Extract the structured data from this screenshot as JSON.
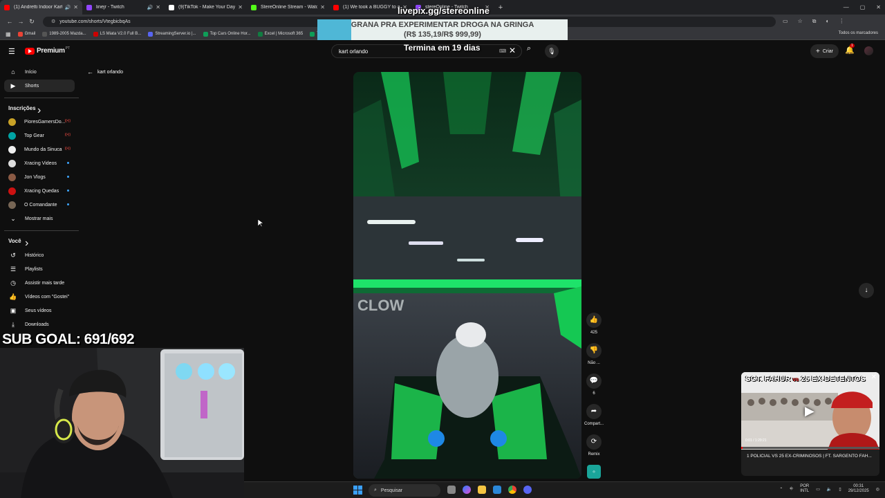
{
  "browser": {
    "tabs": [
      {
        "label": "(1) Andretti Indoor Karting",
        "color": "#ff0000",
        "active": true,
        "sound": "🔊"
      },
      {
        "label": "linejr - Twitch",
        "color": "#9146ff",
        "sound": "🔊"
      },
      {
        "label": "(9)TikTok - Make Your Day",
        "color": "#ffffff"
      },
      {
        "label": "StereOnline Stream - Watch Li...",
        "color": "#53fc18"
      },
      {
        "label": "(1) We took a BUGGY to a 50...",
        "color": "#ff0000"
      },
      {
        "label": "stereOnline - Twitch",
        "color": "#9146ff"
      }
    ],
    "new_tab": "+",
    "url": "youtube.com/shorts/VtegbicbqAs",
    "bookmarks": [
      {
        "label": "Gmail",
        "color": "#ea4335"
      },
      {
        "label": "1989-2005 Mazda...",
        "color": "#555555"
      },
      {
        "label": "LS Miata V2.0 Full B...",
        "color": "#cc0000"
      },
      {
        "label": "StreamingServer.io |...",
        "color": "#5865f2"
      },
      {
        "label": "Top Cars Online Hor...",
        "color": "#0f9d58"
      },
      {
        "label": "Excel | Microsoft 365",
        "color": "#107c41"
      },
      {
        "label": "T",
        "color": "#0f9d58"
      }
    ],
    "all_bookmarks": "Todos os marcadores"
  },
  "youtube": {
    "brand": "Premium",
    "brand_sup": "PT",
    "search_value": "kart orlando",
    "create_label": "Criar",
    "notifications_count": "1",
    "back_label": "kart orlando"
  },
  "sidebar": {
    "main": [
      {
        "label": "Início",
        "icon": "⌂"
      },
      {
        "label": "Shorts",
        "icon": "▶"
      }
    ],
    "subs_header": "Inscrições",
    "subs": [
      {
        "label": "PioresGamersDo...",
        "color": "#c9a227",
        "marker": "live"
      },
      {
        "label": "Top Gear",
        "color": "#00a3a3",
        "marker": "live"
      },
      {
        "label": "Mundo da Sinuca",
        "color": "#eeeeee",
        "marker": "live"
      },
      {
        "label": "Xracing Videos",
        "color": "#dddddd",
        "marker": "dot"
      },
      {
        "label": "Jon Vlogs",
        "color": "#8a5a44",
        "marker": "dot"
      },
      {
        "label": "Xracing Quedas",
        "color": "#cc1111",
        "marker": "dot"
      },
      {
        "label": "O Comandante",
        "color": "#776655",
        "marker": "dot"
      }
    ],
    "show_more": "Mostrar mais",
    "you_header": "Você",
    "you": [
      {
        "label": "Histórico",
        "icon": "↺"
      },
      {
        "label": "Playlists",
        "icon": "☰"
      },
      {
        "label": "Assistir mais tarde",
        "icon": "◷"
      },
      {
        "label": "Vídeos com \"Gostei\"",
        "icon": "👍"
      },
      {
        "label": "Seus vídeos",
        "icon": "▣"
      },
      {
        "label": "Downloads",
        "icon": "⤓"
      }
    ]
  },
  "overlay": {
    "url": "livepix.gg/stereonline",
    "goal_line1": "GRANA PRA EXPERIMENTAR DROGA NA GRINGA",
    "goal_line2": "(R$ 135,19/R$ 999,99)",
    "goal_progress": 0.135,
    "days": "Termina em 19 dias",
    "sub_goal": "SUB GOAL: 691/692"
  },
  "actions": [
    {
      "label": "425",
      "icon": "👍"
    },
    {
      "label": "Não ...",
      "icon": "👎"
    },
    {
      "label": "6",
      "icon": "💬"
    },
    {
      "label": "Compart...",
      "icon": "➦"
    },
    {
      "label": "Remix",
      "icon": "⟳"
    }
  ],
  "mini_player": {
    "thumb_title_a": "SGT. FAHUR",
    "thumb_title_vs": "vs",
    "thumb_title_b": "25 EX-DETENTOS",
    "time": "0:01 / 1:29:21",
    "progress": 0.01,
    "label": "1 POLICIAL VS 25 EX-CRIMINOSOS | FT. SARGENTO FAH..."
  },
  "taskbar": {
    "search": "Pesquisar",
    "lang1": "POR",
    "lang2": "INTL",
    "time": "00:31",
    "date": "29/12/2025"
  }
}
